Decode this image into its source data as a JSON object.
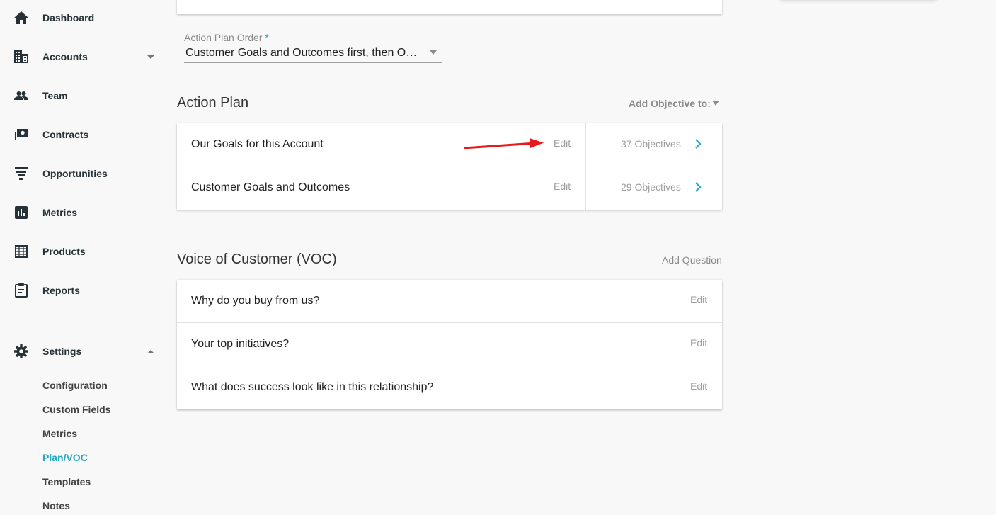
{
  "sidebar": {
    "items": [
      {
        "label": "Dashboard",
        "icon": "home-icon"
      },
      {
        "label": "Accounts",
        "icon": "building-icon"
      },
      {
        "label": "Team",
        "icon": "people-icon"
      },
      {
        "label": "Contracts",
        "icon": "money-icon"
      },
      {
        "label": "Opportunities",
        "icon": "funnel-icon"
      },
      {
        "label": "Metrics",
        "icon": "bar-chart-icon"
      },
      {
        "label": "Products",
        "icon": "grid-icon"
      },
      {
        "label": "Reports",
        "icon": "clipboard-icon"
      }
    ],
    "settings": {
      "label": "Settings",
      "icon": "gear-icon"
    },
    "sub_items": [
      {
        "label": "Configuration"
      },
      {
        "label": "Custom Fields"
      },
      {
        "label": "Metrics"
      },
      {
        "label": "Plan/VOC",
        "active": true
      },
      {
        "label": "Templates"
      },
      {
        "label": "Notes"
      }
    ]
  },
  "action_plan_order": {
    "label": "Action Plan Order",
    "required_mark": "*",
    "value": "Customer Goals and Outcomes first, then Our Goals for this Account"
  },
  "action_plan": {
    "title": "Action Plan",
    "add_objective_label": "Add Objective to:",
    "rows": [
      {
        "label": "Our Goals for this Account",
        "edit": "Edit",
        "count": "37 Objectives"
      },
      {
        "label": "Customer Goals and Outcomes",
        "edit": "Edit",
        "count": "29 Objectives"
      }
    ]
  },
  "voc": {
    "title": "Voice of Customer (VOC)",
    "add_question_label": "Add Question",
    "rows": [
      {
        "label": "Why do you buy from us?",
        "edit": "Edit"
      },
      {
        "label": "Your top initiatives?",
        "edit": "Edit"
      },
      {
        "label": "What does success look like in this relationship?",
        "edit": "Edit"
      }
    ]
  },
  "colors": {
    "accent": "#26a6bf",
    "annotation_arrow": "#e8191a",
    "nav_icon": "#263238"
  }
}
